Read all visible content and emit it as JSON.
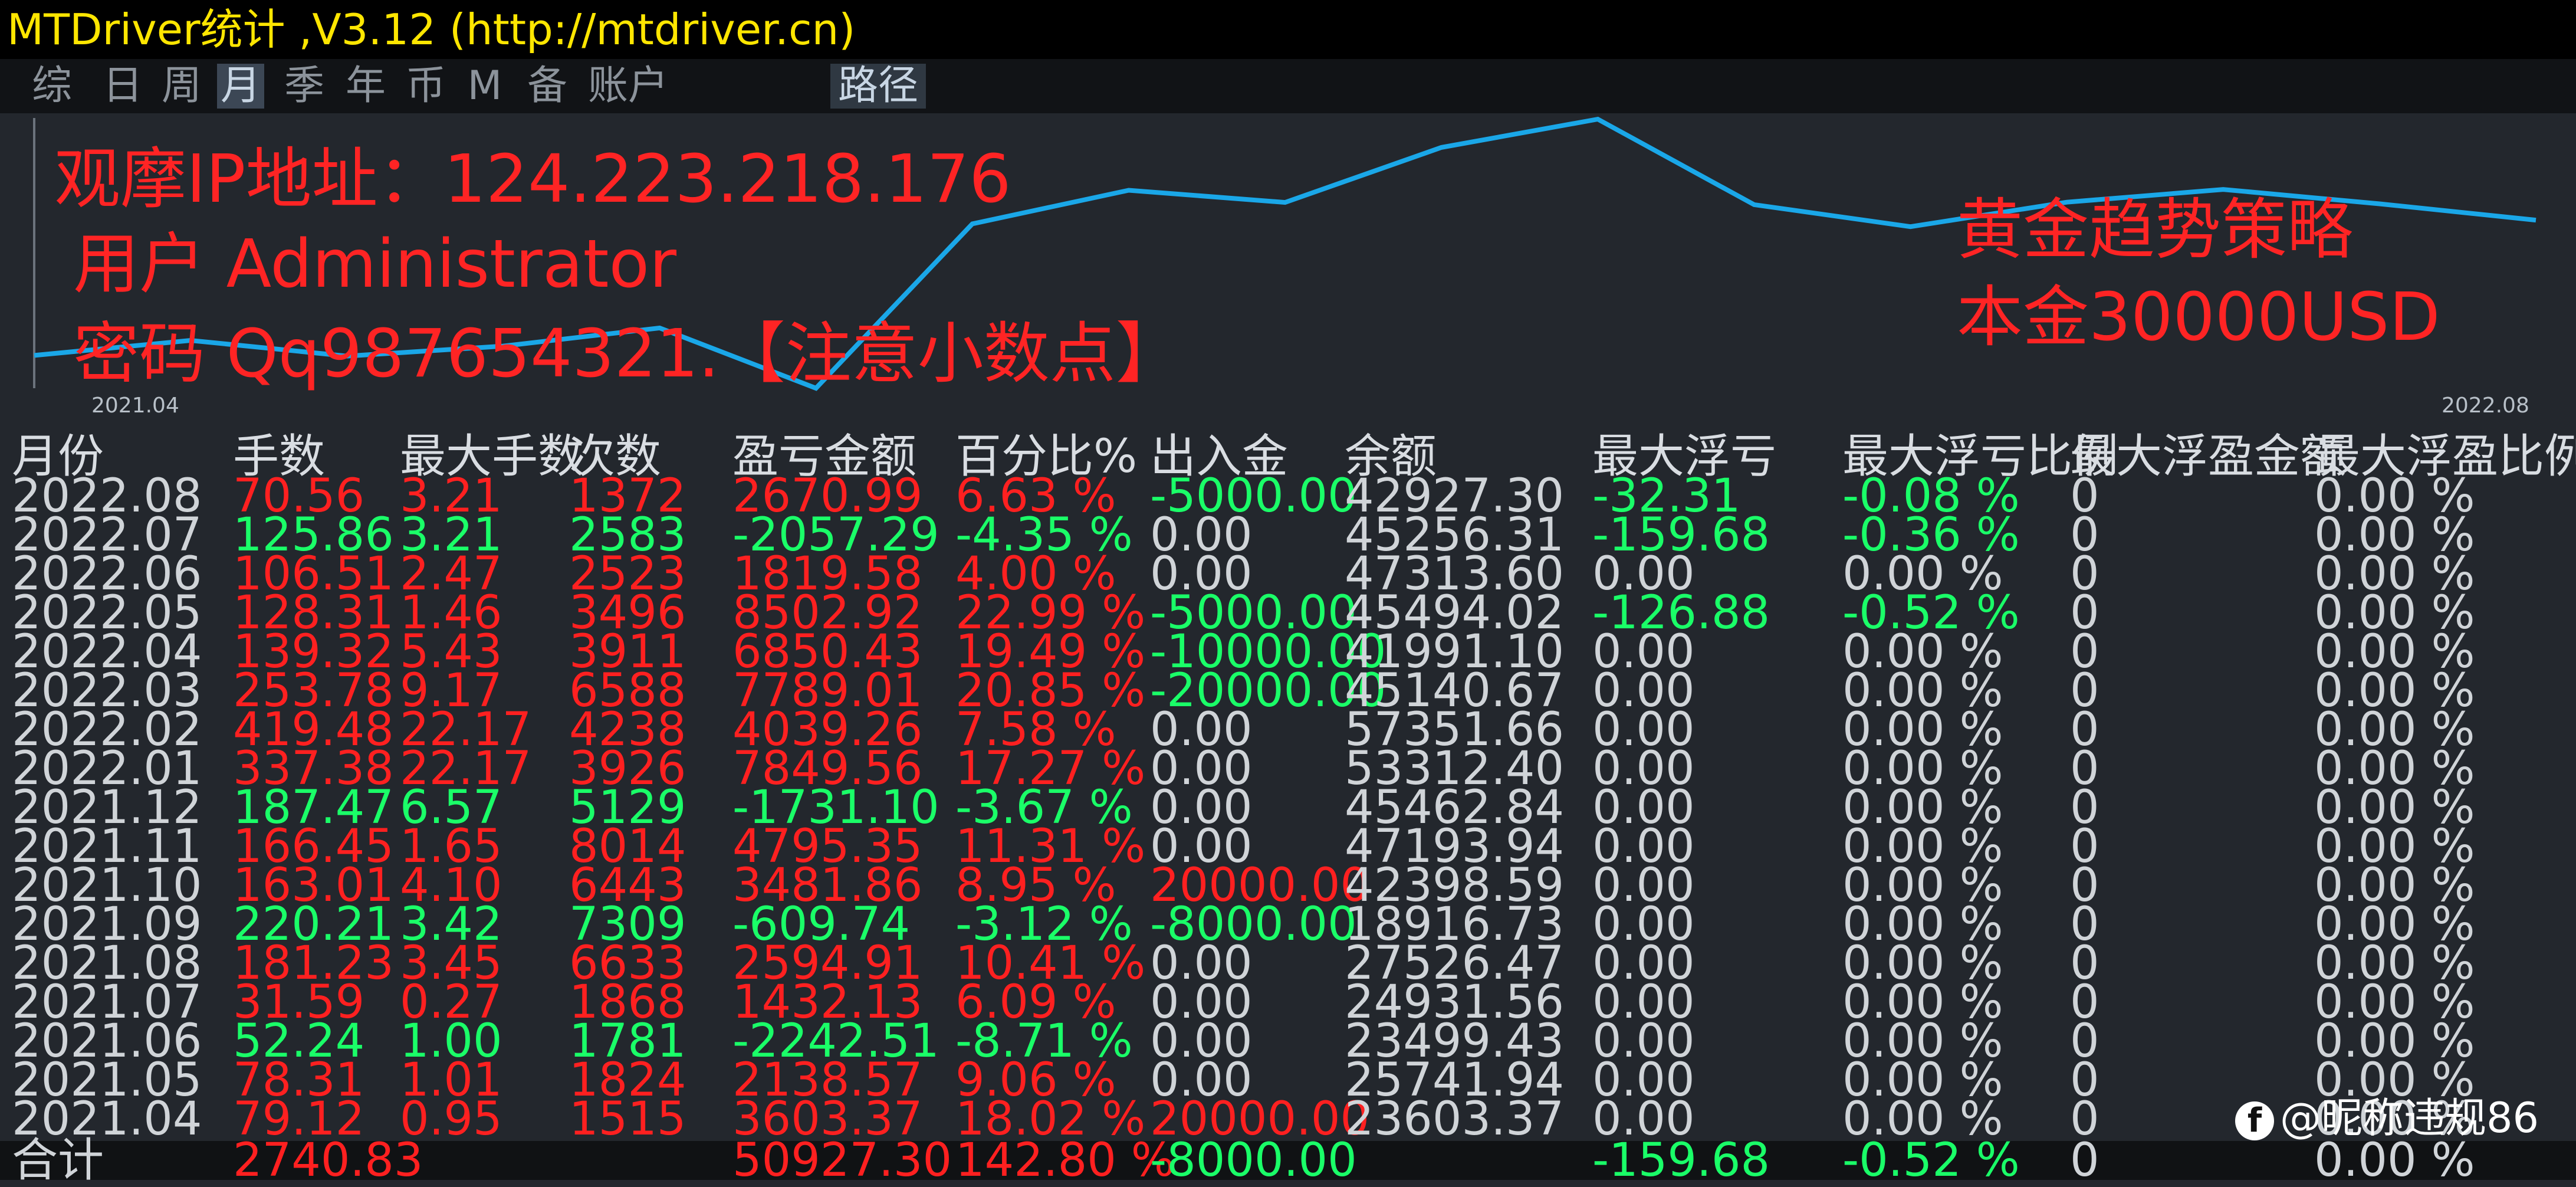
{
  "window": {
    "title": "MTDriver统计 ,V3.12 (http://mtdriver.cn)"
  },
  "menu": {
    "items": [
      "综",
      "日",
      "周",
      "月",
      "季",
      "年",
      "币",
      "M",
      "备",
      "账户"
    ],
    "active": "月",
    "path_label": "路径"
  },
  "overlay": {
    "ip": "观摩IP地址：124.223.218.176",
    "user": "用户 Administrator",
    "password": "密码 Qq987654321.【注意小数点】",
    "strategy": "黄金趋势策略",
    "capital": "本金30000USD"
  },
  "chart_data": {
    "type": "line",
    "title": "",
    "xlabel": "",
    "ylabel": "",
    "x_tick_labels": [
      "2021.04",
      "2022.08"
    ],
    "line_color": "#1aa7e8",
    "grid": false,
    "y_from_table": "余额"
  },
  "table": {
    "columns": [
      "月份",
      "手数",
      "最大手数",
      "次数",
      "盈亏金额",
      "百分比%",
      "出入金",
      "余额",
      "最大浮亏",
      "最大浮亏比例",
      "最大浮盈金额",
      "最大浮盈比例"
    ],
    "rows": [
      [
        "2022.08",
        "70.56",
        "3.21",
        "1372",
        "2670.99",
        "6.63 %",
        "-5000.00",
        "42927.30",
        "-32.31",
        "-0.08 %",
        "0",
        "0.00 %"
      ],
      [
        "2022.07",
        "125.86",
        "3.21",
        "2583",
        "-2057.29",
        "-4.35 %",
        "0.00",
        "45256.31",
        "-159.68",
        "-0.36 %",
        "0",
        "0.00 %"
      ],
      [
        "2022.06",
        "106.51",
        "2.47",
        "2523",
        "1819.58",
        "4.00 %",
        "0.00",
        "47313.60",
        "0.00",
        "0.00 %",
        "0",
        "0.00 %"
      ],
      [
        "2022.05",
        "128.31",
        "1.46",
        "3496",
        "8502.92",
        "22.99 %",
        "-5000.00",
        "45494.02",
        "-126.88",
        "-0.52 %",
        "0",
        "0.00 %"
      ],
      [
        "2022.04",
        "139.32",
        "5.43",
        "3911",
        "6850.43",
        "19.49 %",
        "-10000.00",
        "41991.10",
        "0.00",
        "0.00 %",
        "0",
        "0.00 %"
      ],
      [
        "2022.03",
        "253.78",
        "9.17",
        "6588",
        "7789.01",
        "20.85 %",
        "-20000.00",
        "45140.67",
        "0.00",
        "0.00 %",
        "0",
        "0.00 %"
      ],
      [
        "2022.02",
        "419.48",
        "22.17",
        "4238",
        "4039.26",
        "7.58 %",
        "0.00",
        "57351.66",
        "0.00",
        "0.00 %",
        "0",
        "0.00 %"
      ],
      [
        "2022.01",
        "337.38",
        "22.17",
        "3926",
        "7849.56",
        "17.27 %",
        "0.00",
        "53312.40",
        "0.00",
        "0.00 %",
        "0",
        "0.00 %"
      ],
      [
        "2021.12",
        "187.47",
        "6.57",
        "5129",
        "-1731.10",
        "-3.67 %",
        "0.00",
        "45462.84",
        "0.00",
        "0.00 %",
        "0",
        "0.00 %"
      ],
      [
        "2021.11",
        "166.45",
        "1.65",
        "8014",
        "4795.35",
        "11.31 %",
        "0.00",
        "47193.94",
        "0.00",
        "0.00 %",
        "0",
        "0.00 %"
      ],
      [
        "2021.10",
        "163.01",
        "4.10",
        "6443",
        "3481.86",
        "8.95 %",
        "20000.00",
        "42398.59",
        "0.00",
        "0.00 %",
        "0",
        "0.00 %"
      ],
      [
        "2021.09",
        "220.21",
        "3.42",
        "7309",
        "-609.74",
        "-3.12 %",
        "-8000.00",
        "18916.73",
        "0.00",
        "0.00 %",
        "0",
        "0.00 %"
      ],
      [
        "2021.08",
        "181.23",
        "3.45",
        "6633",
        "2594.91",
        "10.41 %",
        "0.00",
        "27526.47",
        "0.00",
        "0.00 %",
        "0",
        "0.00 %"
      ],
      [
        "2021.07",
        "31.59",
        "0.27",
        "1868",
        "1432.13",
        "6.09 %",
        "0.00",
        "24931.56",
        "0.00",
        "0.00 %",
        "0",
        "0.00 %"
      ],
      [
        "2021.06",
        "52.24",
        "1.00",
        "1781",
        "-2242.51",
        "-8.71 %",
        "0.00",
        "23499.43",
        "0.00",
        "0.00 %",
        "0",
        "0.00 %"
      ],
      [
        "2021.05",
        "78.31",
        "1.01",
        "1824",
        "2138.57",
        "9.06 %",
        "0.00",
        "25741.94",
        "0.00",
        "0.00 %",
        "0",
        "0.00 %"
      ],
      [
        "2021.04",
        "79.12",
        "0.95",
        "1515",
        "3603.37",
        "18.02 %",
        "20000.00",
        "23603.37",
        "0.00",
        "0.00 %",
        "0",
        "0.00 %"
      ]
    ],
    "total": [
      "合计",
      "2740.83",
      "",
      "",
      "50927.30",
      "142.80 %",
      "-8000.00",
      "",
      "-159.68",
      "-0.52 %",
      "0",
      "0.00 %"
    ]
  },
  "colors": {
    "positive": "#ff2020",
    "negative": "#1aff68",
    "neutral": "#d0d4d8",
    "accent": "#ffe600"
  },
  "watermark": {
    "logo_icon": "f",
    "text": "@昵称违规86"
  }
}
